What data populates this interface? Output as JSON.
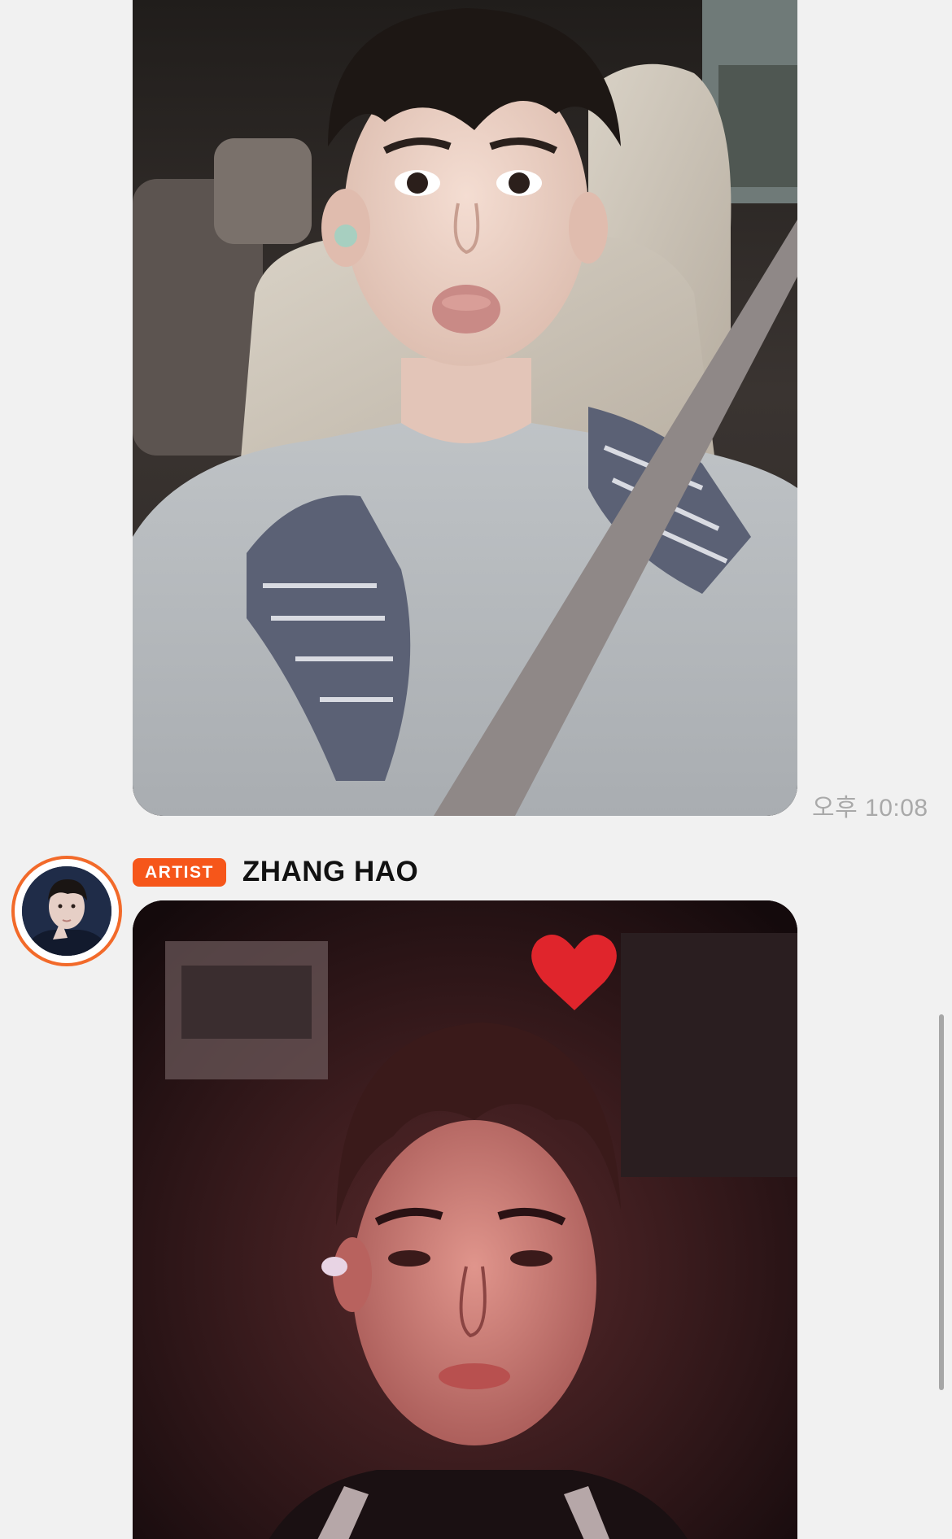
{
  "messages": [
    {
      "type": "photo",
      "photo_icon": "car-selfie-photo",
      "time": "오후 10:08"
    },
    {
      "type": "photo",
      "photo_icon": "backstage-red-light-photo",
      "sender": {
        "badge": "ARTIST",
        "name": "ZHANG HAO",
        "avatar_icon": "profile-avatar"
      }
    }
  ],
  "colors": {
    "background": "#f1f1f1",
    "badge": "#f6561a",
    "avatar_ring": "#f26a2a",
    "timestamp": "#a9a9a9"
  }
}
